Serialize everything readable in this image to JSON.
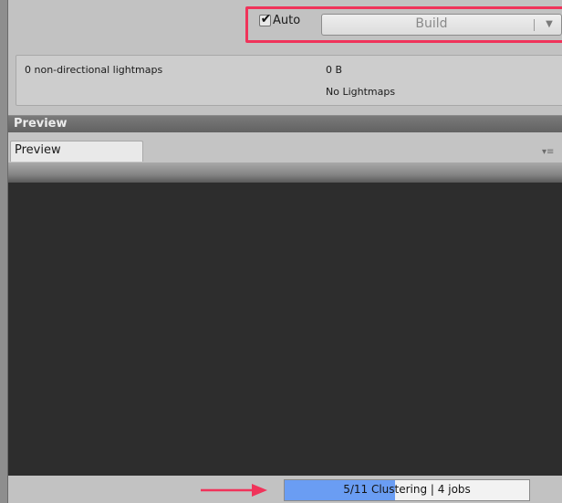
{
  "toolbar": {
    "auto_label": "Auto",
    "auto_checked": true,
    "build_label": "Build"
  },
  "lightmaps": {
    "count_text": "0 non-directional lightmaps",
    "size_text": "0 B",
    "status_text": "No Lightmaps"
  },
  "preview": {
    "header_title": "Preview",
    "tab_label": "Preview"
  },
  "progress": {
    "label": "5/11 Clustering | 4 jobs",
    "fraction": 0.45
  },
  "colors": {
    "highlight": "#f0335a",
    "progress_fill": "#6a9df3",
    "viewport": "#2d2d2d"
  },
  "icons": {
    "check": "check-icon",
    "dropdown": "chevron-down-icon",
    "tab_menu": "menu-icon",
    "arrow": "arrow-right-icon"
  }
}
